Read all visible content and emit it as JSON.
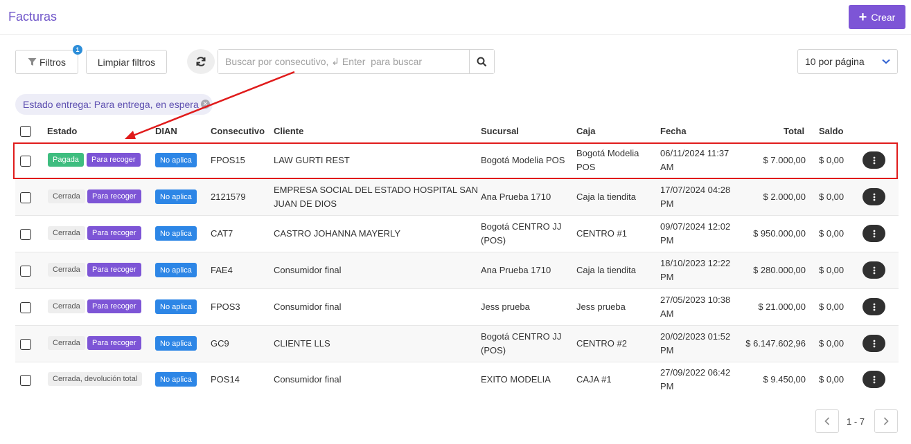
{
  "header": {
    "title": "Facturas",
    "create_label": "Crear"
  },
  "toolbar": {
    "filters_label": "Filtros",
    "filters_badge": "1",
    "clear_label": "Limpiar filtros",
    "search_placeholder": "Buscar por consecutivo, ↲ Enter  para buscar",
    "per_page": "10 por página"
  },
  "active_filter": "Estado entrega: Para entrega, en espera",
  "columns": {
    "estado": "Estado",
    "dian": "DIAN",
    "consecutivo": "Consecutivo",
    "cliente": "Cliente",
    "sucursal": "Sucursal",
    "caja": "Caja",
    "fecha": "Fecha",
    "total": "Total",
    "saldo": "Saldo"
  },
  "rows": [
    {
      "estado": "Pagada",
      "entrega": "Para recoger",
      "dian": "No aplica",
      "consecutivo": "FPOS15",
      "cliente_1": "LAW GURTI REST",
      "cliente_2": "",
      "sucursal_1": "Bogotá Modelia POS",
      "sucursal_2": "",
      "caja_1": "Bogotá Modelia",
      "caja_2": "POS",
      "fecha_1": "06/11/2024 11:37",
      "fecha_2": "AM",
      "total": "$ 7.000,00",
      "saldo": "$ 0,00"
    },
    {
      "estado": "Cerrada",
      "entrega": "Para recoger",
      "dian": "No aplica",
      "consecutivo": "2121579",
      "cliente_1": "EMPRESA SOCIAL DEL ESTADO HOSPITAL SAN",
      "cliente_2": "JUAN DE DIOS",
      "sucursal_1": "Ana Prueba 1710",
      "sucursal_2": "",
      "caja_1": "Caja la tiendita",
      "caja_2": "",
      "fecha_1": "17/07/2024 04:28",
      "fecha_2": "PM",
      "total": "$ 2.000,00",
      "saldo": "$ 0,00"
    },
    {
      "estado": "Cerrada",
      "entrega": "Para recoger",
      "dian": "No aplica",
      "consecutivo": "CAT7",
      "cliente_1": "CASTRO JOHANNA MAYERLY",
      "cliente_2": "",
      "sucursal_1": "Bogotá CENTRO JJ",
      "sucursal_2": "(POS)",
      "caja_1": "CENTRO #1",
      "caja_2": "",
      "fecha_1": "09/07/2024 12:02",
      "fecha_2": "PM",
      "total": "$ 950.000,00",
      "saldo": "$ 0,00"
    },
    {
      "estado": "Cerrada",
      "entrega": "Para recoger",
      "dian": "No aplica",
      "consecutivo": "FAE4",
      "cliente_1": "Consumidor final",
      "cliente_2": "",
      "sucursal_1": "Ana Prueba 1710",
      "sucursal_2": "",
      "caja_1": "Caja la tiendita",
      "caja_2": "",
      "fecha_1": "18/10/2023 12:22",
      "fecha_2": "PM",
      "total": "$ 280.000,00",
      "saldo": "$ 0,00"
    },
    {
      "estado": "Cerrada",
      "entrega": "Para recoger",
      "dian": "No aplica",
      "consecutivo": "FPOS3",
      "cliente_1": "Consumidor final",
      "cliente_2": "",
      "sucursal_1": "Jess prueba",
      "sucursal_2": "",
      "caja_1": "Jess prueba",
      "caja_2": "",
      "fecha_1": "27/05/2023 10:38",
      "fecha_2": "AM",
      "total": "$ 21.000,00",
      "saldo": "$ 0,00"
    },
    {
      "estado": "Cerrada",
      "entrega": "Para recoger",
      "dian": "No aplica",
      "consecutivo": "GC9",
      "cliente_1": "CLIENTE LLS",
      "cliente_2": "",
      "sucursal_1": "Bogotá CENTRO JJ",
      "sucursal_2": "(POS)",
      "caja_1": "CENTRO #2",
      "caja_2": "",
      "fecha_1": "20/02/2023 01:52",
      "fecha_2": "PM",
      "total": "$ 6.147.602,96",
      "saldo": "$ 0,00"
    },
    {
      "estado": "Cerrada, devolución total",
      "entrega": "",
      "dian": "No aplica",
      "consecutivo": "POS14",
      "cliente_1": "Consumidor final",
      "cliente_2": "",
      "sucursal_1": "EXITO MODELIA",
      "sucursal_2": "",
      "caja_1": "CAJA #1",
      "caja_2": "",
      "fecha_1": "27/09/2022 06:42",
      "fecha_2": "PM",
      "total": "$ 9.450,00",
      "saldo": "$ 0,00"
    }
  ],
  "pagination": {
    "range": "1 - 7"
  },
  "colors": {
    "accent": "#7d55d6",
    "paid": "#3ebd7f",
    "dian": "#2d86e6",
    "annotation": "#e01b1b"
  }
}
